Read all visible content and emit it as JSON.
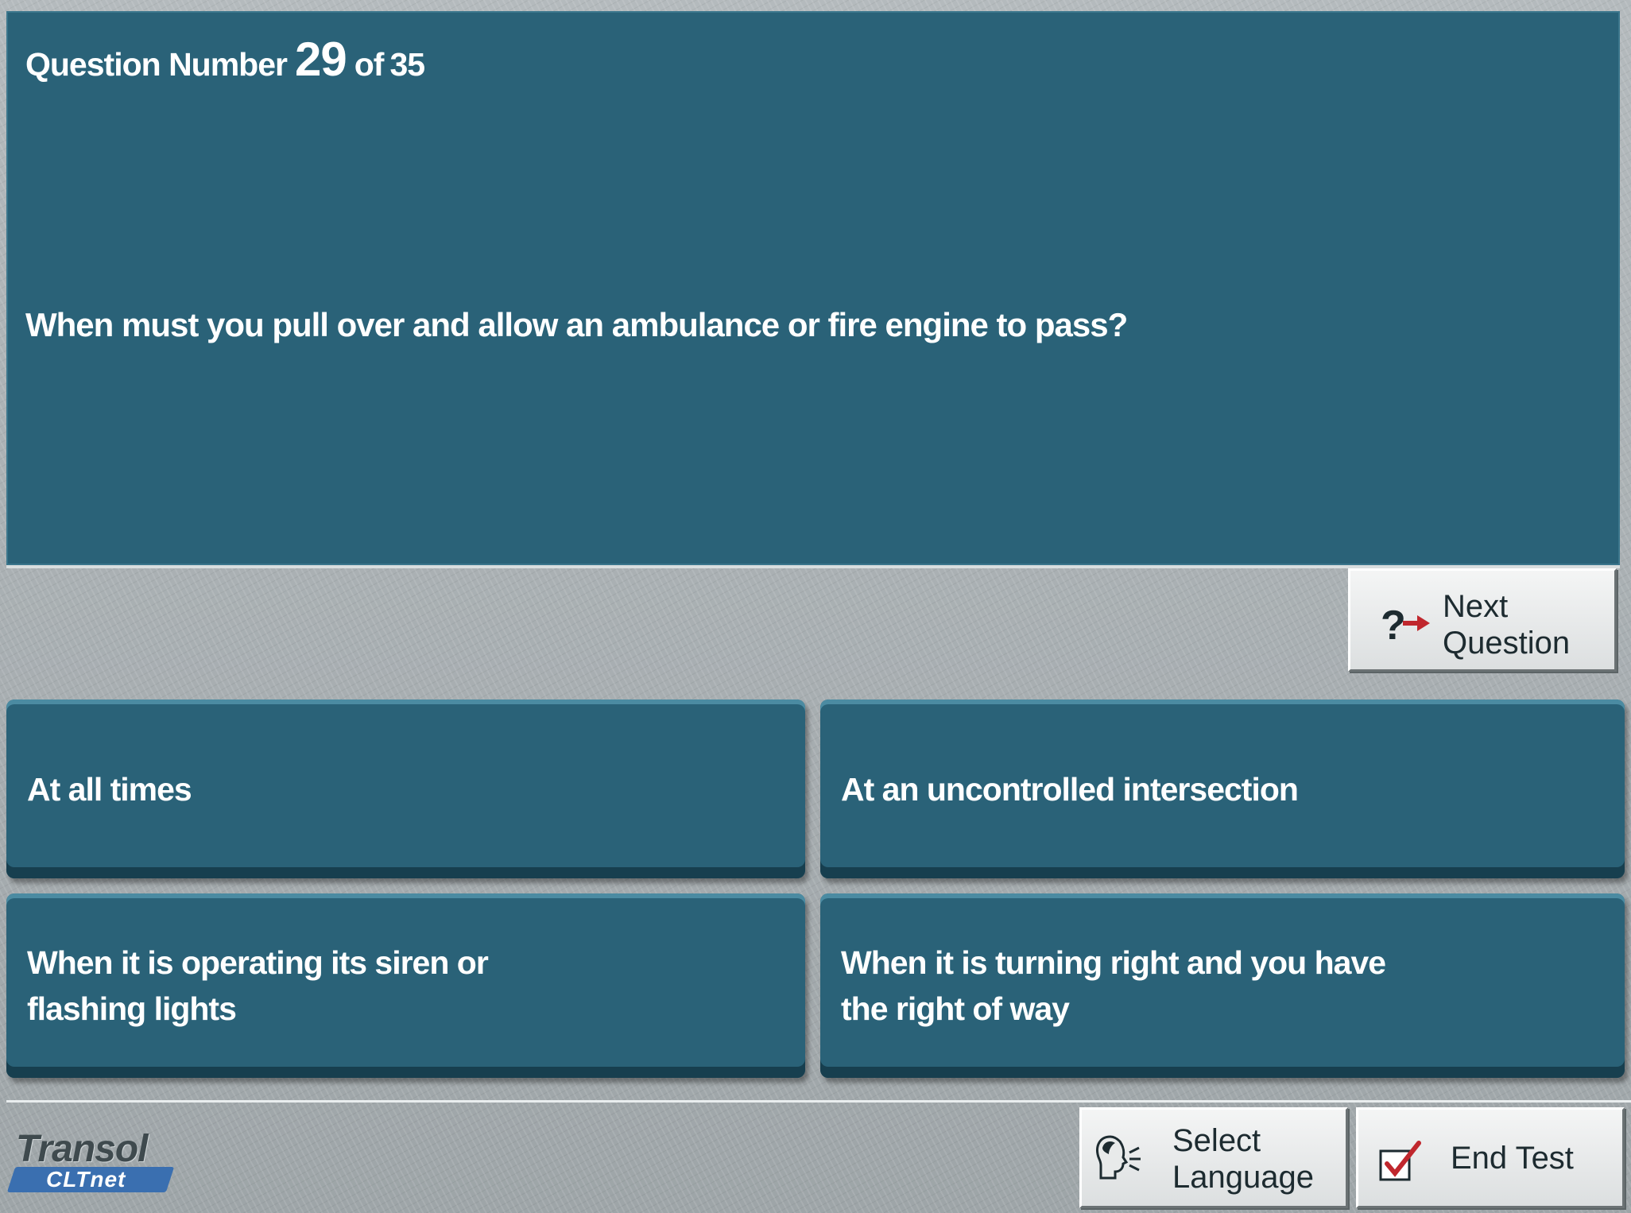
{
  "header": {
    "question_label": "Question Number",
    "question_number": "29",
    "of_label": "of",
    "total_questions": "35"
  },
  "question": {
    "text": "When must you pull over and allow an ambulance or fire engine to pass?"
  },
  "answers": [
    {
      "label": "At all times"
    },
    {
      "label": "At an uncontrolled intersection"
    },
    {
      "label": "When it is operating its siren or flashing lights"
    },
    {
      "label": "When it is turning right and you have the right of way"
    }
  ],
  "buttons": {
    "next_line1": "Next",
    "next_line2": "Question",
    "language_line1": "Select",
    "language_line2": "Language",
    "end_test": "End Test"
  },
  "logo": {
    "brand": "Transol",
    "sub": "CLTnet"
  },
  "icons": {
    "next": "question-arrow-icon",
    "language": "speaking-head-icon",
    "end": "checkbox-check-icon"
  },
  "colors": {
    "panel": "#2a6278",
    "background": "#a7aeb1",
    "arrow_red": "#c0272d"
  }
}
